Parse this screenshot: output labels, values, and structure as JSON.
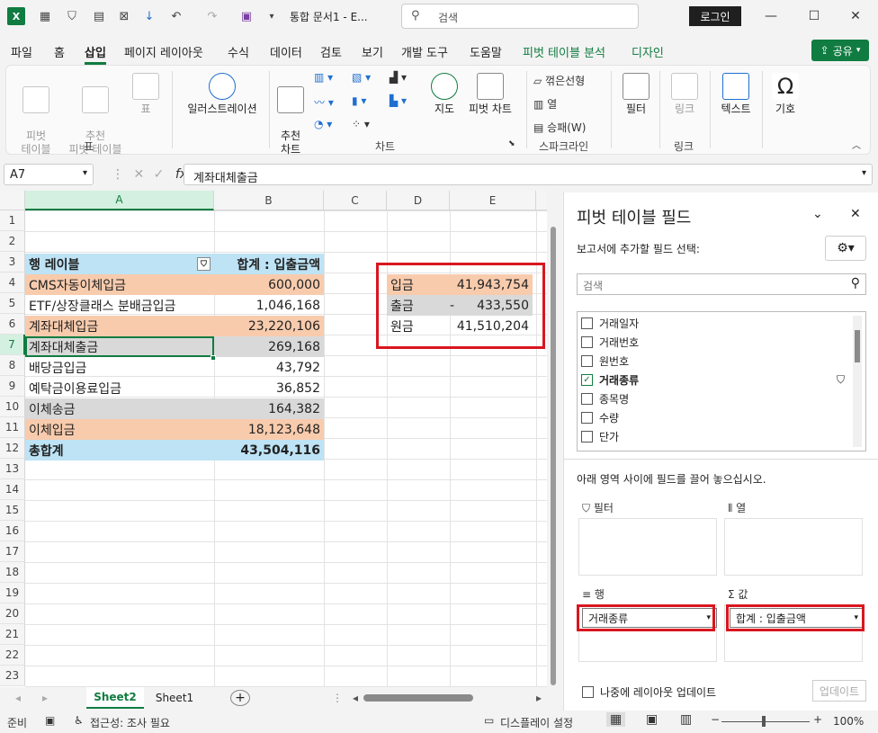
{
  "title_bar": {
    "doc_title": "통합 문서1 - E...",
    "search_placeholder": "검색",
    "login_label": "로그인"
  },
  "menu": {
    "tabs": [
      "파일",
      "홈",
      "삽입",
      "페이지 레이아웃",
      "수식",
      "데이터",
      "검토",
      "보기",
      "개발 도구",
      "도움말",
      "피벗 테이블 분석",
      "디자인"
    ],
    "active": "삽입",
    "share_label": "공유"
  },
  "ribbon": {
    "pivot_table": "피벗\n테이블",
    "recommended_pivot": "추천\n피벗 테이블",
    "table": "표",
    "group_table": "표",
    "illustration": "일러스트레이션",
    "recommended_chart": "추천\n차트",
    "map": "지도",
    "pivot_chart": "피벗 차트",
    "group_chart": "차트",
    "spark_line": "꺾은선형",
    "spark_column": "열",
    "spark_winloss": "승패(W)",
    "group_sparkline": "스파크라인",
    "filter": "필터",
    "link": "링크",
    "group_link": "링크",
    "text": "텍스트",
    "symbol": "기호"
  },
  "formula_bar": {
    "name_box": "A7",
    "fx": "fx",
    "content": "계좌대체출금"
  },
  "grid": {
    "columns": [
      "A",
      "B",
      "C",
      "D",
      "E"
    ],
    "rows": [
      "1",
      "2",
      "3",
      "4",
      "5",
      "6",
      "7",
      "8",
      "9",
      "10",
      "11",
      "12",
      "13",
      "14",
      "15",
      "16",
      "17",
      "18",
      "19",
      "20",
      "21",
      "22",
      "23"
    ],
    "pivot_header": {
      "label": "행 레이블",
      "value": "합계 : 입출금액"
    },
    "pivot_rows": [
      {
        "label": "CMS자동이체입금",
        "value": "600,000"
      },
      {
        "label": "ETF/상장클래스 분배금입금",
        "value": "1,046,168"
      },
      {
        "label": "계좌대체입금",
        "value": "23,220,106"
      },
      {
        "label": "계좌대체출금",
        "value": "269,168"
      },
      {
        "label": "배당금입금",
        "value": "43,792"
      },
      {
        "label": "예탁금이용료입금",
        "value": "36,852"
      },
      {
        "label": "이체송금",
        "value": "164,382"
      },
      {
        "label": "이체입금",
        "value": "18,123,648"
      }
    ],
    "pivot_total": {
      "label": "총합계",
      "value": "43,504,116"
    },
    "summary": [
      {
        "label": "입금",
        "sign": "",
        "value": "41,943,754"
      },
      {
        "label": "출금",
        "sign": "-",
        "value": "433,550"
      },
      {
        "label": "원금",
        "sign": "",
        "value": "41,510,204"
      }
    ]
  },
  "sheets": [
    "Sheet2",
    "Sheet1"
  ],
  "active_sheet": "Sheet2",
  "status": {
    "ready": "준비",
    "accessibility": "접근성: 조사 필요",
    "display": "디스플레이 설정",
    "zoom": "100%"
  },
  "pivot_pane": {
    "title": "피벗 테이블 필드",
    "choose_label": "보고서에 추가할 필드 선택:",
    "search_placeholder": "검색",
    "fields": [
      {
        "name": "거래일자",
        "checked": false
      },
      {
        "name": "거래번호",
        "checked": false
      },
      {
        "name": "원번호",
        "checked": false
      },
      {
        "name": "거래종류",
        "checked": true
      },
      {
        "name": "종목명",
        "checked": false
      },
      {
        "name": "수량",
        "checked": false
      },
      {
        "name": "단가",
        "checked": false
      }
    ],
    "drag_hint": "아래 영역 사이에 필드를 끌어 놓으십시오.",
    "area_filter": "필터",
    "area_columns": "열",
    "area_rows": "행",
    "area_values": "값",
    "rows_item": "거래종류",
    "values_item": "합계 : 입출금액",
    "defer_label": "나중에 레이아웃 업데이트",
    "update_label": "업데이트"
  },
  "colors": {
    "accent": "#107c41",
    "pivot_header": "#bde3f5",
    "orange_row": "#f8cbad",
    "gray_row": "#d9d9d9",
    "highlight_red": "#d9161f"
  }
}
